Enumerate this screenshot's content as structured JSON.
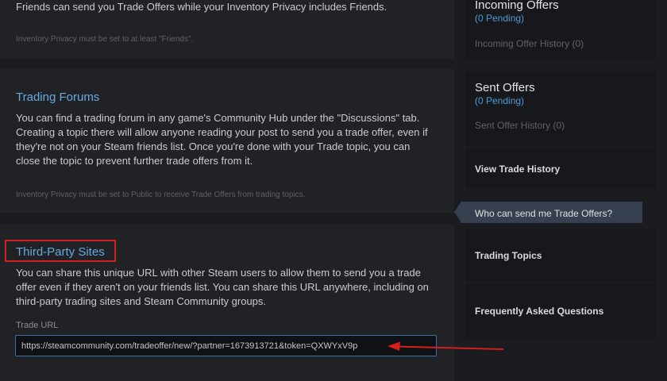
{
  "main": {
    "section1": {
      "text": "Friends can send you Trade Offers while your Inventory Privacy includes Friends.",
      "note": "Inventory Privacy must be set to at least \"Friends\"."
    },
    "trading_forums": {
      "title": "Trading Forums",
      "text": "You can find a trading forum in any game's Community Hub under the \"Discussions\" tab. Creating a topic there will allow anyone reading your post to send you a trade offer, even if they're not on your Steam friends list. Once you're done with your Trade topic, you can close the topic to prevent further trade offers from it.",
      "note": "Inventory Privacy must be set to Public to receive Trade Offers from trading topics."
    },
    "third_party": {
      "title": "Third-Party Sites",
      "text": "You can share this unique URL with other Steam users to allow them to send you a trade offer even if they aren't on your friends list. You can share this URL anywhere, including on third-party trading sites and Steam Community groups.",
      "trade_url_label": "Trade URL",
      "trade_url_value": "https://steamcommunity.com/tradeoffer/new/?partner=1673913721&token=QXWYxV9p"
    }
  },
  "sidebar": {
    "incoming": {
      "heading": "Incoming Offers",
      "pending": "(0 Pending)",
      "history": "Incoming Offer History (0)"
    },
    "sent": {
      "heading": "Sent Offers",
      "pending": "(0 Pending)",
      "history": "Sent Offer History (0)"
    },
    "view_trade_history": "View Trade History",
    "who_can_send": "Who can send me Trade Offers?",
    "trading_topics": "Trading Topics",
    "faq": "Frequently Asked Questions"
  },
  "colors": {
    "accent_blue": "#66a9df",
    "highlight_red": "#d21f1f",
    "active_item_bg": "#37404f"
  }
}
